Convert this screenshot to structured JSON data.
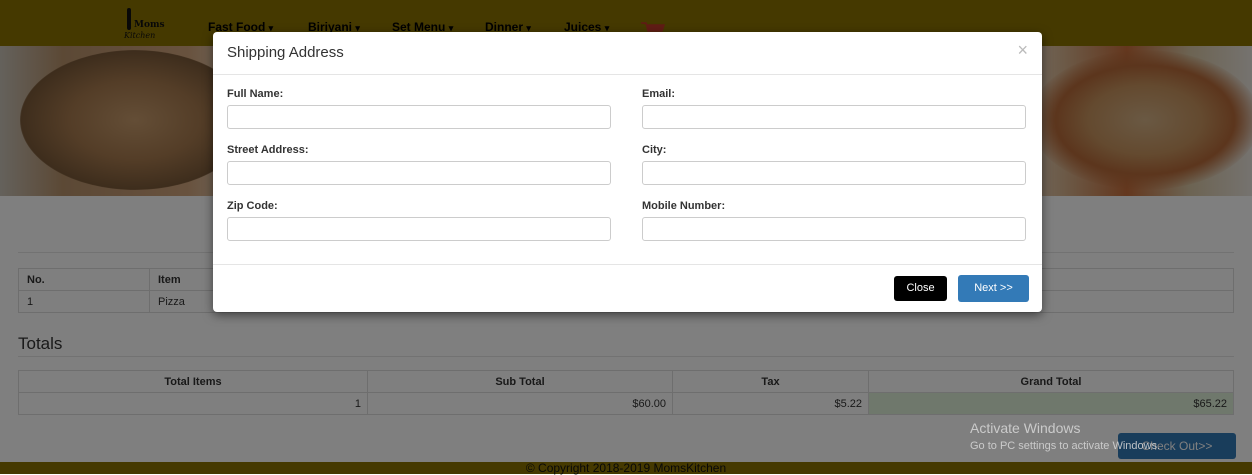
{
  "nav": {
    "logo_moms": "Moms",
    "logo_kitchen": "Kitchen",
    "items": [
      {
        "label": "Fast Food"
      },
      {
        "label": "Biriyani"
      },
      {
        "label": "Set Menu"
      },
      {
        "label": "Dinner"
      },
      {
        "label": "Juices"
      }
    ],
    "caret": "▾"
  },
  "items_table": {
    "headers": [
      "No.",
      "Item"
    ],
    "rows": [
      [
        "1",
        "Pizza"
      ]
    ]
  },
  "totals": {
    "title": "Totals",
    "headers": [
      "Total Items",
      "Sub Total",
      "Tax",
      "Grand Total"
    ],
    "values": [
      "1",
      "$60.00",
      "$5.22",
      "$65.22"
    ]
  },
  "checkout": {
    "icon": "cart-icon",
    "label": "Check Out>>"
  },
  "watermark": {
    "title": "Activate Windows",
    "subtitle": "Go to PC settings to activate Windows."
  },
  "footer": {
    "text": "© Copyright 2018-2019 MomsKitchen"
  },
  "modal": {
    "title": "Shipping Address",
    "close_glyph": "×",
    "fields": {
      "full_name": {
        "label": "Full Name:",
        "value": "",
        "placeholder": ""
      },
      "email": {
        "label": "Email:",
        "value": "",
        "placeholder": ""
      },
      "street": {
        "label": "Street Address:",
        "value": "",
        "placeholder": ""
      },
      "city": {
        "label": "City:",
        "value": "",
        "placeholder": ""
      },
      "zip": {
        "label": "Zip Code:",
        "value": "",
        "placeholder": ""
      },
      "mobile": {
        "label": "Mobile Number:",
        "value": "",
        "placeholder": ""
      }
    },
    "close_button": "Close",
    "next_button": "Next >>"
  },
  "colors": {
    "navbar": "#8b7300",
    "primary": "#337ab7",
    "grand_total_bg": "#dff0d8"
  }
}
